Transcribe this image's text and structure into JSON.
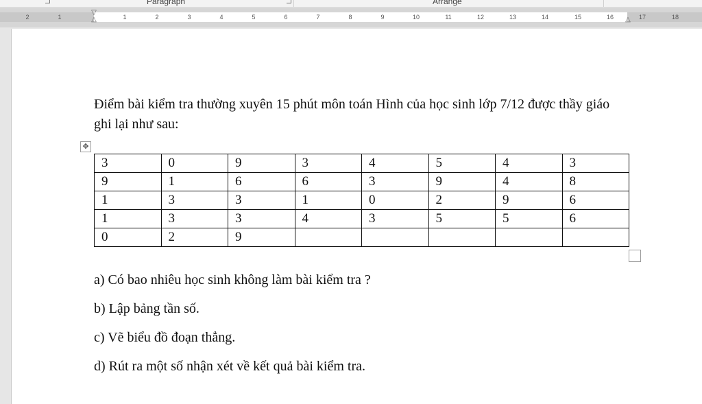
{
  "ribbon": {
    "groups": [
      "Paragraph",
      "Arrange"
    ]
  },
  "ruler": {
    "labels": [
      "2",
      "1",
      "1",
      "2",
      "3",
      "4",
      "5",
      "6",
      "7",
      "8",
      "9",
      "10",
      "11",
      "12",
      "13",
      "14",
      "15",
      "16",
      "17",
      "18"
    ]
  },
  "document": {
    "intro": "Điểm bài kiểm tra thường xuyên 15 phút môn toán Hình của học sinh lớp 7/12 được thầy giáo ghi lại như sau:",
    "table": [
      [
        "3",
        "0",
        "9",
        "3",
        "4",
        "5",
        "4",
        "3"
      ],
      [
        "9",
        "1",
        "6",
        "6",
        "3",
        "9",
        "4",
        "8"
      ],
      [
        "1",
        "3",
        "3",
        "1",
        "0",
        "2",
        "9",
        "6"
      ],
      [
        "1",
        "3",
        "3",
        "4",
        "3",
        "5",
        "5",
        "6"
      ],
      [
        "0",
        "2",
        "9",
        "",
        "",
        "",
        "",
        ""
      ]
    ],
    "questions": [
      "a) Có bao nhiêu học sinh không làm bài kiểm tra ?",
      "b) Lập bảng tần số.",
      "c) Vẽ biểu đồ đoạn thẳng.",
      "d) Rút ra một số nhận xét về kết quả bài kiểm tra."
    ]
  }
}
